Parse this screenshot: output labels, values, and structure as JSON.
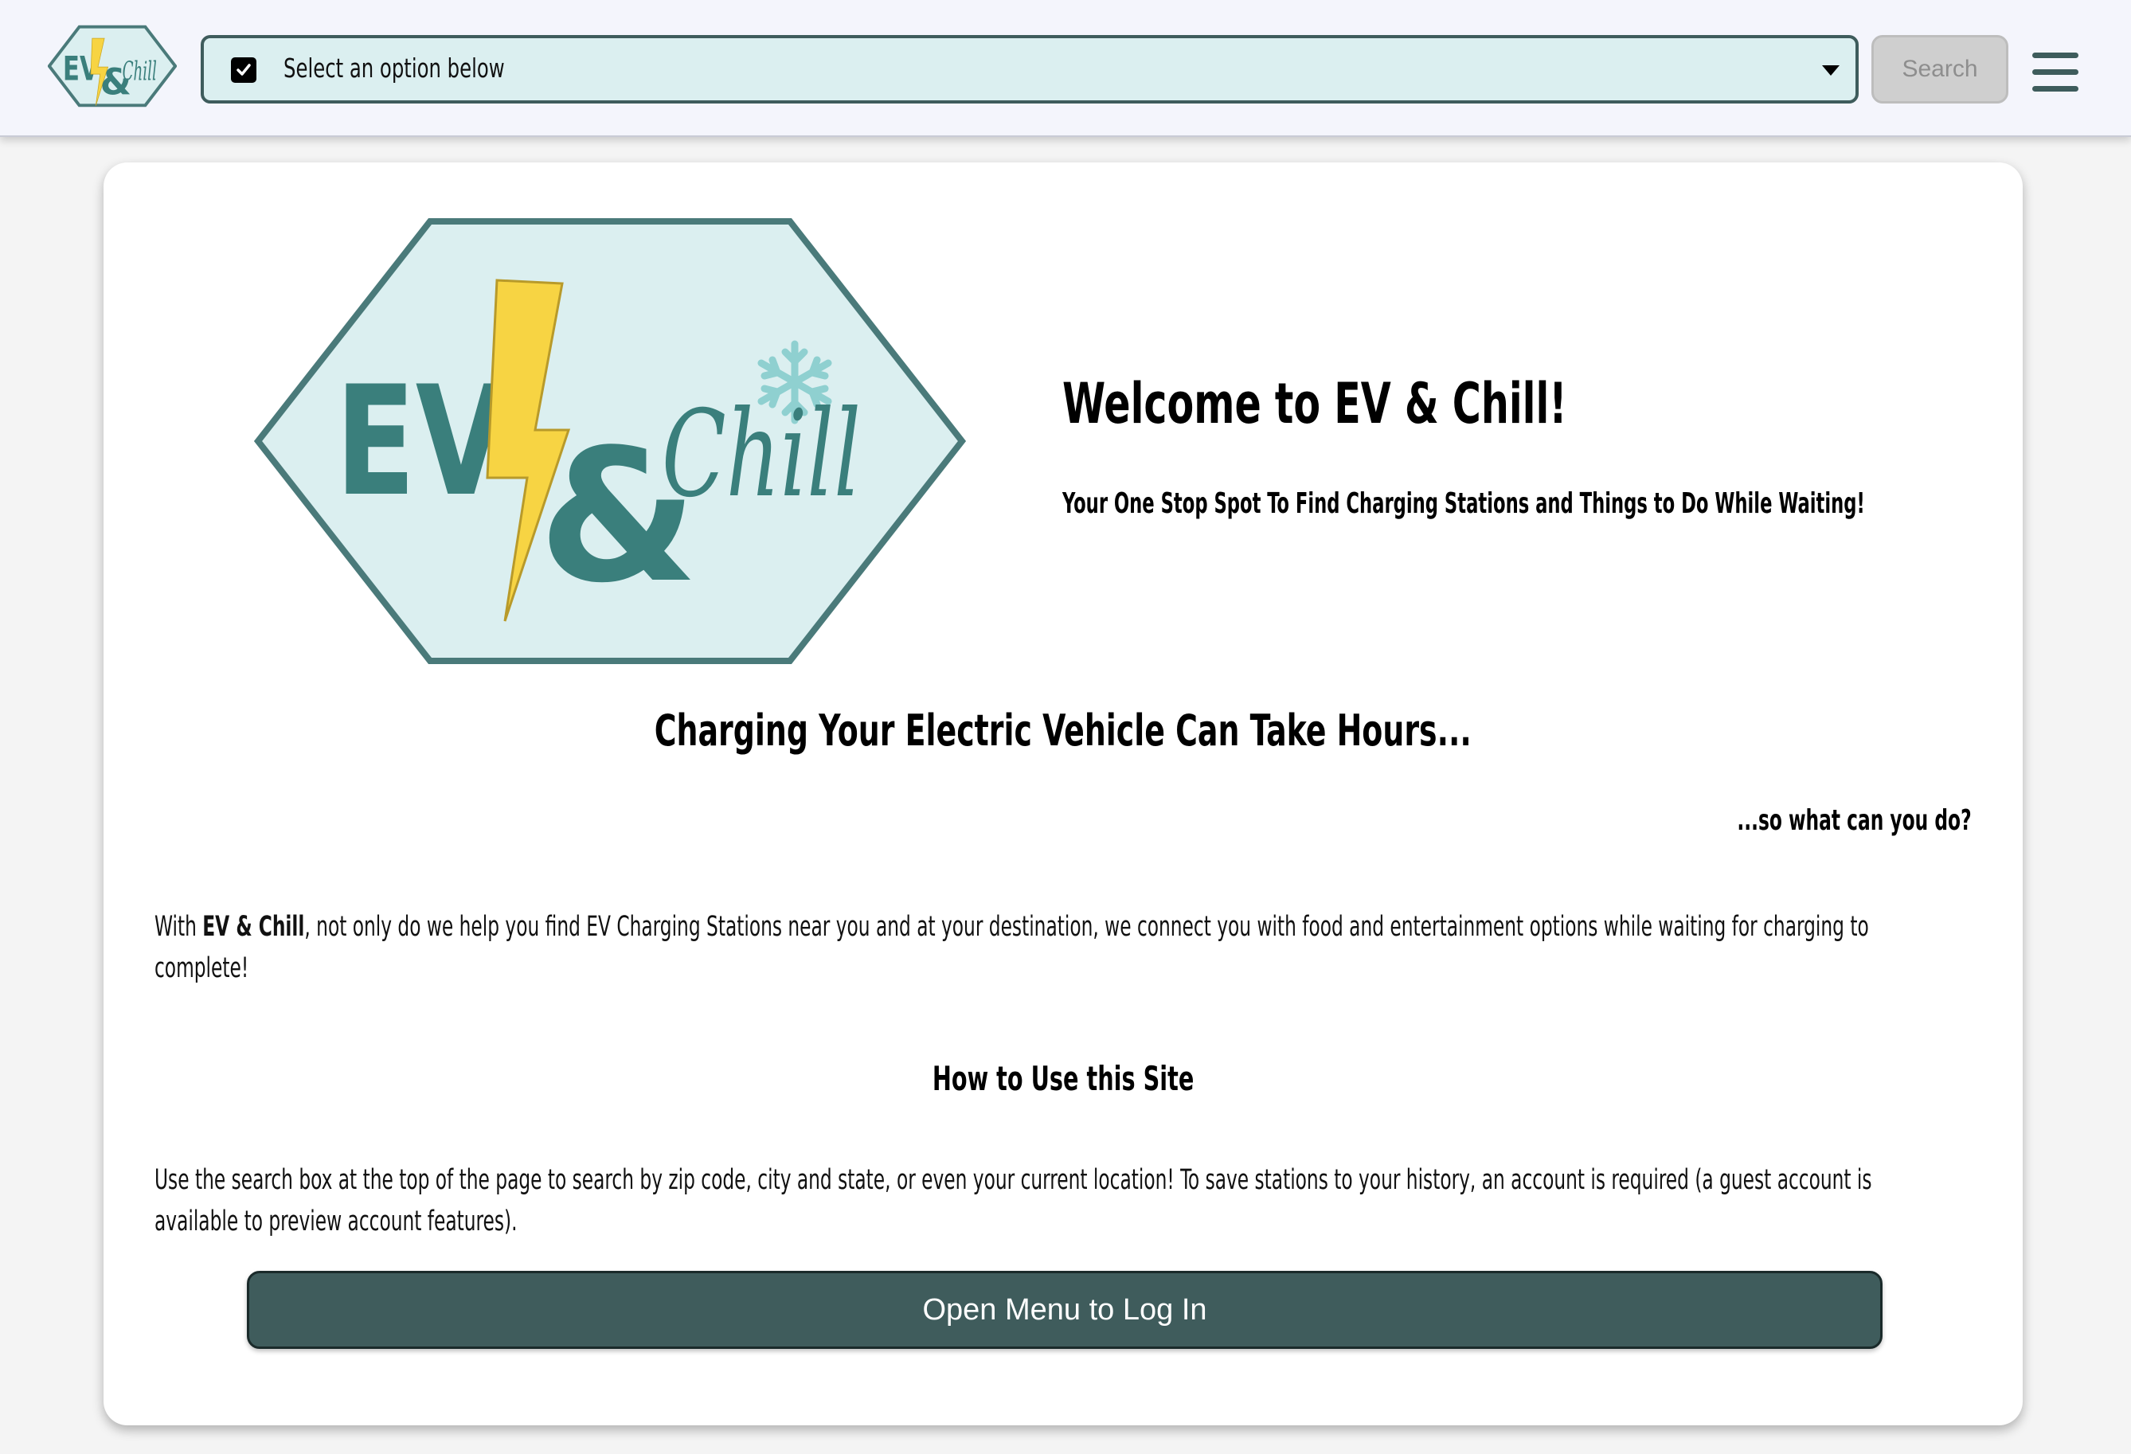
{
  "header": {
    "logo_alt": "EV & Chill",
    "select_value": "Select an option below",
    "search_label": "Search"
  },
  "hero": {
    "logo_text_ev": "EV",
    "logo_text_and": "&",
    "logo_text_chill": "Chill",
    "title": "Welcome to EV & Chill!",
    "subtitle": "Your One Stop Spot To Find Charging Stations and Things to Do While Waiting!"
  },
  "content": {
    "hours_heading": "Charging Your Electric Vehicle Can Take Hours...",
    "what_can_do": "...so what can you do?",
    "intro_prefix": "With ",
    "intro_brand": "EV & Chill",
    "intro_rest": ", not only do we help you find EV Charging Stations near you and at your destination, we connect you with food and entertainment options while waiting for charging to complete!",
    "how_heading": "How to Use this Site",
    "how_text": "Use the search box at the top of the page to search by zip code, city and state, or even your current location! To save stations to your history, an account is required (a guest account is available to preview account features).",
    "login_button": "Open Menu to Log In"
  },
  "colors": {
    "teal_dark": "#3f5c5c",
    "teal_logo": "#3a7f7c",
    "hex_fill": "#dbeff0",
    "bolt_yellow": "#f7d443",
    "snowflake": "#8fd0d0"
  }
}
